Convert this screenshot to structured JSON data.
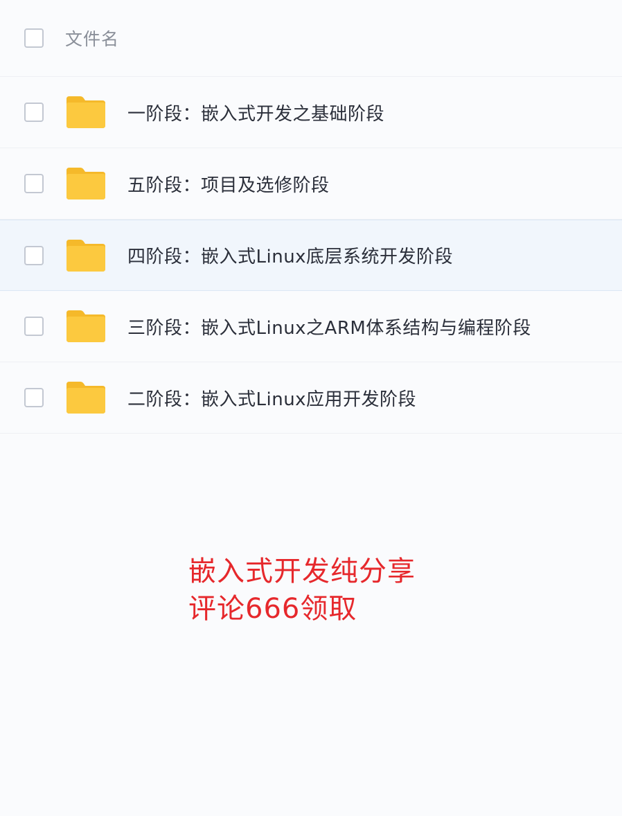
{
  "header": {
    "column_label": "文件名"
  },
  "files": [
    {
      "name": "一阶段：嵌入式开发之基础阶段",
      "icon": "folder-icon",
      "selected": false
    },
    {
      "name": "五阶段：项目及选修阶段",
      "icon": "folder-icon",
      "selected": false
    },
    {
      "name": "四阶段：嵌入式Linux底层系统开发阶段",
      "icon": "folder-icon",
      "selected": true
    },
    {
      "name": "三阶段：嵌入式Linux之ARM体系结构与编程阶段",
      "icon": "folder-icon",
      "selected": false
    },
    {
      "name": "二阶段：嵌入式Linux应用开发阶段",
      "icon": "folder-icon",
      "selected": false
    }
  ],
  "promo": {
    "line1": "嵌入式开发纯分享",
    "line2": "评论666领取"
  },
  "colors": {
    "folder": "#fcc93f",
    "folder_tab": "#f5b92a",
    "promo_text": "#e6282c",
    "selected_row": "#f1f6fc"
  }
}
